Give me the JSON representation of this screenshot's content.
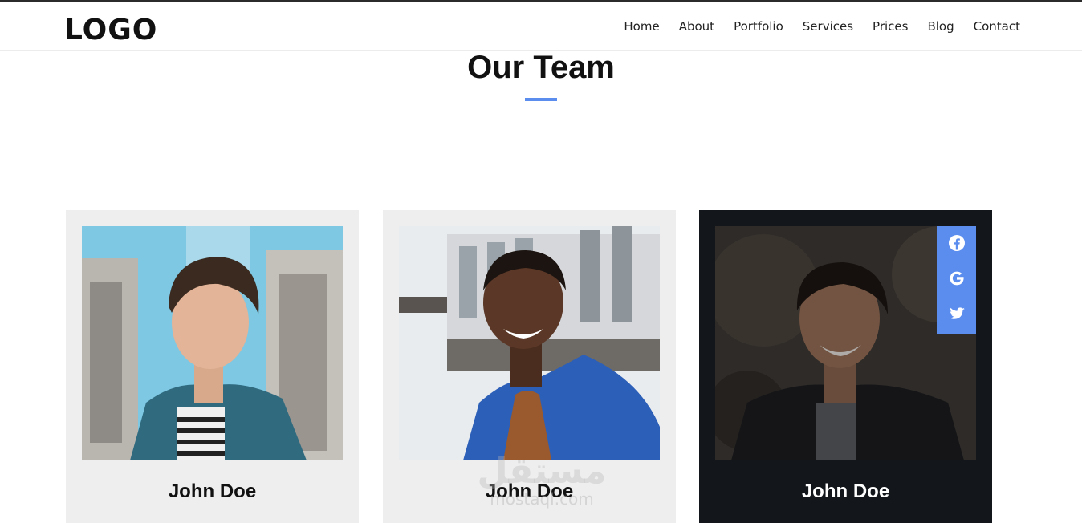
{
  "header": {
    "logo": "LOGO",
    "nav": [
      "Home",
      "About",
      "Portfolio",
      "Services",
      "Prices",
      "Blog",
      "Contact"
    ]
  },
  "section": {
    "title": "Our Team"
  },
  "team": [
    {
      "name": "John Doe"
    },
    {
      "name": "John Doe"
    },
    {
      "name": "John Doe"
    }
  ],
  "social_icons": [
    "facebook-icon",
    "google-icon",
    "twitter-icon"
  ],
  "watermark": {
    "arabic": "مستقل",
    "latin": "mostaql.com"
  },
  "colors": {
    "accent": "#5b8def",
    "dark_card": "#13171b",
    "light_card": "#eeeeee",
    "topbar": "#2b2b2b"
  }
}
